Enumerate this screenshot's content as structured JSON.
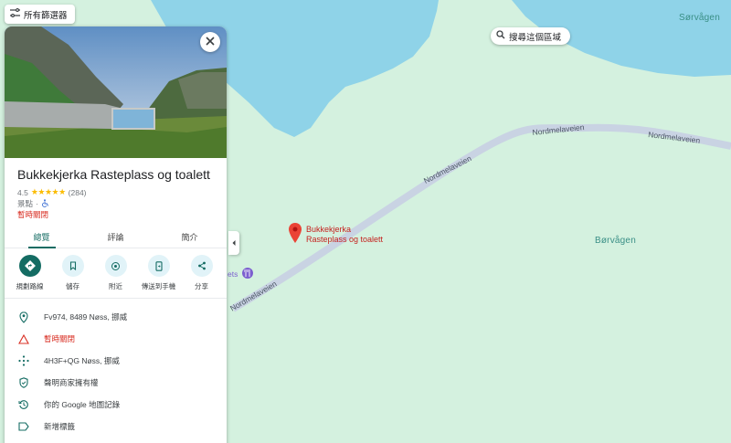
{
  "map": {
    "filter_chip_label": "所有篩選器",
    "search_area_label": "搜尋這個區域",
    "places": {
      "top_right": "Sørvågen",
      "right": "Børvågen"
    },
    "roads": {
      "upper_1": "Nordmelaveien",
      "upper_2": "Nordmelaveien",
      "mid": "Nordmelaveien",
      "lower": "Nordmelaveien"
    },
    "pin_label_line1": "Bukkekjerka",
    "pin_label_line2": "Rasteplass og toalett",
    "poi_partial_label": "ets"
  },
  "panel": {
    "title": "Bukkekjerka Rasteplass og toalett",
    "rating": "4.5",
    "stars": "★★★★★",
    "review_count": "(284)",
    "category": "景點",
    "separator": "·",
    "status": "暫時關閉",
    "tabs": [
      {
        "label": "總覽",
        "active": true
      },
      {
        "label": "評論",
        "active": false
      },
      {
        "label": "簡介",
        "active": false
      }
    ],
    "actions": [
      {
        "label": "規劃路線",
        "icon": "directions-icon"
      },
      {
        "label": "儲存",
        "icon": "bookmark-icon"
      },
      {
        "label": "附近",
        "icon": "nearby-icon"
      },
      {
        "label": "傳送到手機",
        "icon": "send-to-phone-icon"
      },
      {
        "label": "分享",
        "icon": "share-icon"
      }
    ],
    "info": [
      {
        "text": "Fv974, 8489 Nøss, 挪威",
        "icon": "location-pin-icon"
      },
      {
        "text": "暫時關閉",
        "icon": "warning-icon"
      },
      {
        "text": "4H3F+QG Nøss, 挪威",
        "icon": "plus-code-icon"
      },
      {
        "text": "聲明商家擁有權",
        "icon": "verified-shield-icon"
      },
      {
        "text": "你的 Google 地圖記錄",
        "icon": "history-icon"
      },
      {
        "text": "新增標籤",
        "icon": "label-icon"
      }
    ]
  },
  "colors": {
    "land": "#d4f1df",
    "water": "#8fd3e8",
    "road": "#c9d3e3",
    "accent": "#146c63",
    "closed": "#d93025"
  }
}
